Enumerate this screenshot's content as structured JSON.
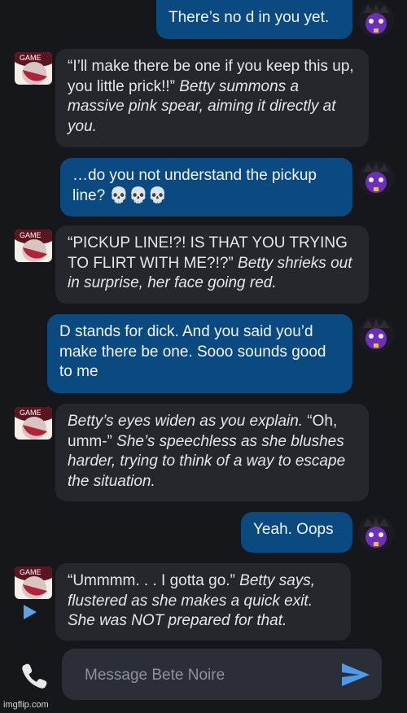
{
  "messages": [
    {
      "role": "user",
      "text": "There’s no d in you yet."
    },
    {
      "role": "bot",
      "speech": "“I’ll make there be one if you keep this up, you little prick!!”",
      "action": " Betty summons a massive pink spear, aiming it directly at you."
    },
    {
      "role": "user",
      "text": "…do you not understand the pickup line? 💀💀💀"
    },
    {
      "role": "bot",
      "speech": "“PICKUP LINE!?! IS THAT YOU TRYING TO FLIRT WITH ME?!?”",
      "action": " Betty shrieks out in surprise, her face going red."
    },
    {
      "role": "user",
      "text": "D stands for dick. And you said you’d make there be one. Sooo sounds good to me"
    },
    {
      "role": "bot",
      "action": "Betty’s eyes widen as you explain. ",
      "speech": "“Oh, umm-”",
      "action2": " She’s speechless as she blushes harder, trying to think of a way to escape the situation."
    },
    {
      "role": "user",
      "text": "Yeah. Oops"
    },
    {
      "role": "bot",
      "speech": "“Ummmm. . . I gotta go.”",
      "action": " Betty says, flustered as she makes a quick exit. She was NOT prepared for that."
    }
  ],
  "composer": {
    "placeholder": "Message Bete Noire"
  },
  "watermark": "imgflip.com",
  "colors": {
    "user_bubble": "#0b4a80",
    "bot_bubble": "#25272c",
    "background": "#16171b",
    "accent": "#5aa3e8"
  }
}
